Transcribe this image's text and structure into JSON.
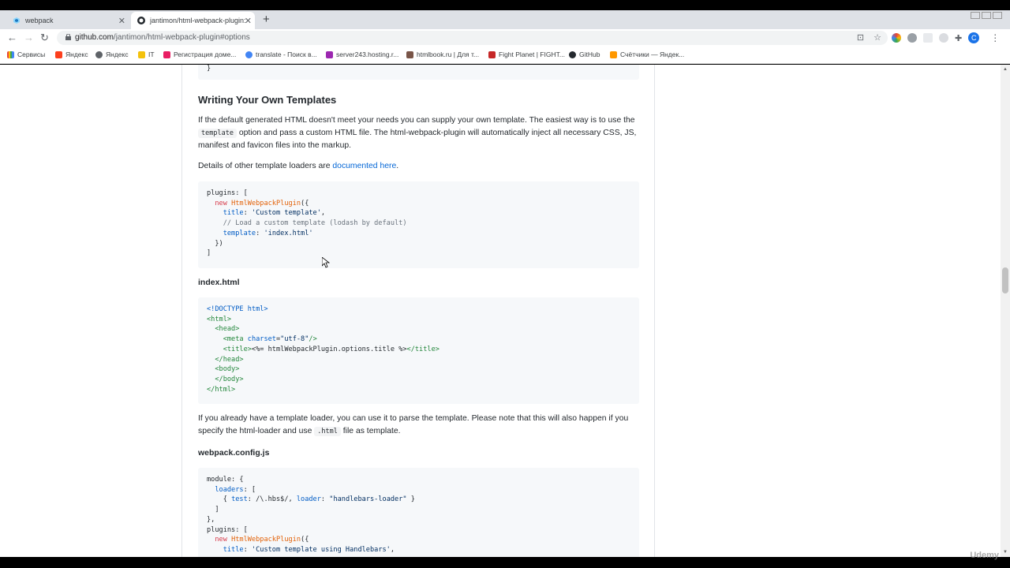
{
  "browser": {
    "tabs": [
      {
        "title": "webpack",
        "close": "✕"
      },
      {
        "title": "jantimon/html-webpack-plugin:",
        "close": "✕"
      }
    ],
    "new_tab": "+",
    "url_host": "github.com",
    "url_path": "/jantimon/html-webpack-plugin#options",
    "avatar_letter": "C",
    "bookmarks": [
      {
        "label": "Сервисы",
        "color": "#e8453c"
      },
      {
        "label": "Яндекс",
        "color": "#fc3f1d"
      },
      {
        "label": "Яндекс",
        "color": "#5f6368"
      },
      {
        "label": "IT",
        "color": "#f4c20d"
      },
      {
        "label": "Регистрация доме...",
        "color": "#e91e63"
      },
      {
        "label": "translate - Поиск в...",
        "color": "#4285f4"
      },
      {
        "label": "server243.hosting.r...",
        "color": "#9c27b0"
      },
      {
        "label": "htmlbook.ru | Для т...",
        "color": "#795548"
      },
      {
        "label": "Fight Planet | FIGHT...",
        "color": "#c62828"
      },
      {
        "label": "GitHub",
        "color": "#24292e"
      },
      {
        "label": "Счётчики — Яндек...",
        "color": "#ff9800"
      }
    ]
  },
  "page": {
    "top_code_tail": "}",
    "heading": "Writing Your Own Templates",
    "para1_a": "If the default generated HTML doesn't meet your needs you can supply your own template. The easiest way is to use the",
    "para1_code": "template",
    "para1_b": "option and pass a custom HTML file. The html-webpack-plugin will automatically inject all necessary CSS, JS, manifest and favicon files into the markup.",
    "para2_a": "Details of other template loaders are",
    "para2_link": "documented here",
    "para2_b": ".",
    "code1": {
      "l1": "plugins: [",
      "l2_kw": "new",
      "l2_fn": "HtmlWebpackPlugin",
      "l2_rest": "({",
      "l3_prop": "title",
      "l3_str": "'Custom template'",
      "l4_cm": "// Load a custom template (lodash by default)",
      "l5_prop": "template",
      "l5_str": "'index.html'",
      "l6": "})",
      "l7": "]"
    },
    "h_index": "index.html",
    "code2": {
      "l1": "<!DOCTYPE html>",
      "l2": "<html>",
      "l3": "<head>",
      "l4_tag": "<meta",
      "l4_attr": "charset",
      "l4_val": "\"utf-8\"",
      "l4_end": "/>",
      "l5_open": "<title>",
      "l5_body": "<%= htmlWebpackPlugin.options.title %>",
      "l5_close": "</title>",
      "l6": "</head>",
      "l7": "<body>",
      "l8": "</body>",
      "l9": "</html>"
    },
    "para3_a": "If you already have a template loader, you can use it to parse the template. Please note that this will also happen if you specify the html-loader and use",
    "para3_code": ".html",
    "para3_b": "file as template.",
    "h_config": "webpack.config.js",
    "code3": {
      "l1": "module: {",
      "l2_prop": "loaders",
      "l2_rest": ": [",
      "l3_a": "{ ",
      "l3_prop1": "test",
      "l3_b": ": /\\.hbs$/, ",
      "l3_prop2": "loader",
      "l3_c": ": ",
      "l3_str": "\"handlebars-loader\"",
      "l3_d": " }",
      "l4": "]",
      "l5": "},",
      "l6": "plugins: [",
      "l7_kw": "new",
      "l7_fn": "HtmlWebpackPlugin",
      "l7_rest": "({",
      "l8_prop": "title",
      "l8_str": "'Custom template using Handlebars'",
      "l8_end": ","
    }
  },
  "watermark": "Udemy"
}
